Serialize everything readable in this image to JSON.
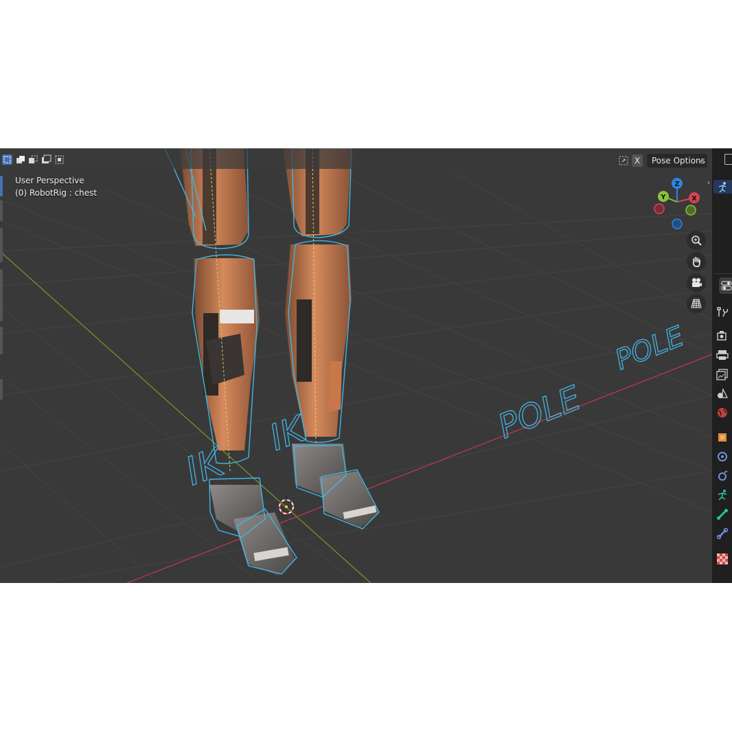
{
  "viewport": {
    "title": "User Perspective",
    "context": "(0) RobotRig : chest",
    "labels": {
      "ik_left": "IK",
      "ik_right": "IK",
      "pole_near": "POLE",
      "pole_far": "POLE"
    }
  },
  "header": {
    "select_modes": [
      "select-set-icon",
      "select-extend-icon",
      "select-subtract-icon",
      "select-difference-icon",
      "select-intersect-icon"
    ],
    "active_mode": "select-set-icon",
    "x_mirror_label": "X",
    "pose_options_label": "Pose Options"
  },
  "navigation_gizmo": {
    "axes": {
      "z": "Z",
      "y": "Y",
      "x": "X"
    },
    "colors": {
      "x": "#d94454",
      "y": "#8ac43b",
      "z": "#2f85e1"
    }
  },
  "nav_buttons": [
    "zoom-icon",
    "pan-hand-icon",
    "camera-view-icon",
    "grid-ortho-icon"
  ],
  "properties_tabs": [
    "tool-icon",
    "render-icon",
    "output-icon",
    "view-layer-icon",
    "scene-icon",
    "world-icon",
    "object-icon",
    "modifiers-icon",
    "particles-icon",
    "physics-icon",
    "object-data-armature-icon",
    "bone-icon",
    "bone-constraints-icon",
    "texture-icon"
  ],
  "colors": {
    "viewport_bg": "#393939",
    "bone_wire": "#41b6e6",
    "robot_orange": "#c8774a",
    "accent": "#4772b3"
  }
}
